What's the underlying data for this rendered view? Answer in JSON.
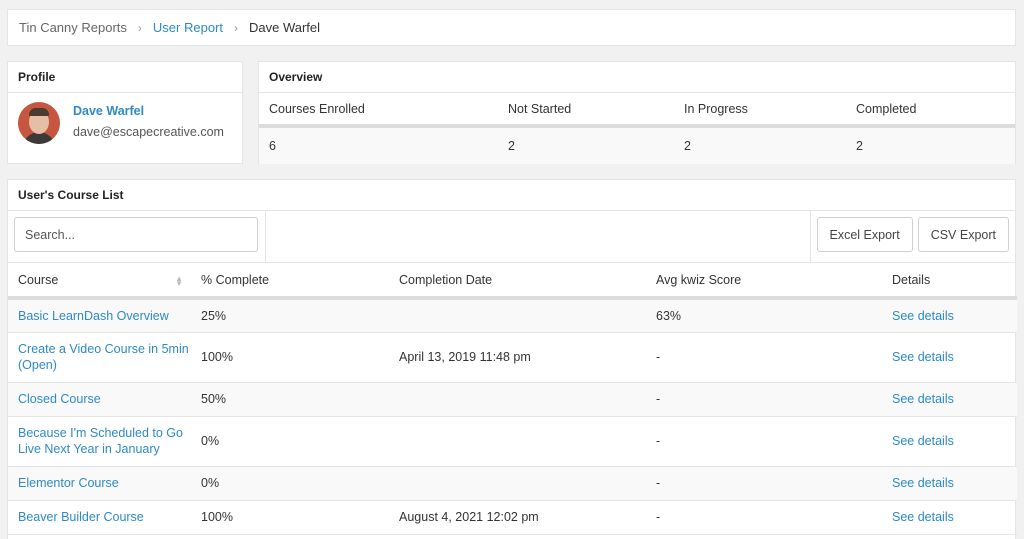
{
  "breadcrumb": [
    "Tin Canny Reports",
    "User Report",
    "Dave Warfel"
  ],
  "profile": {
    "title": "Profile",
    "name": "Dave Warfel",
    "email": "dave@escapecreative.com"
  },
  "overview": {
    "title": "Overview",
    "headers": [
      "Courses Enrolled",
      "Not Started",
      "In Progress",
      "Completed"
    ],
    "values": [
      "6",
      "2",
      "2",
      "2"
    ]
  },
  "course_list": {
    "title": "User's Course List",
    "search_placeholder": "Search...",
    "excel_label": "Excel Export",
    "csv_label": "CSV Export",
    "columns": [
      "Course",
      "% Complete",
      "Completion Date",
      "Avg kwiz Score",
      "Details"
    ],
    "rows": [
      {
        "course": "Basic LearnDash Overview",
        "pct": "25%",
        "date": "",
        "score": "63%",
        "details": "See details"
      },
      {
        "course": "Create a Video Course in 5min (Open)",
        "pct": "100%",
        "date": "April 13, 2019 11:48 pm",
        "score": "-",
        "details": "See details"
      },
      {
        "course": "Closed Course",
        "pct": "50%",
        "date": "",
        "score": "-",
        "details": "See details"
      },
      {
        "course": "Because I'm Scheduled to Go Live Next Year in January",
        "pct": "0%",
        "date": "",
        "score": "-",
        "details": "See details"
      },
      {
        "course": "Elementor Course",
        "pct": "0%",
        "date": "",
        "score": "-",
        "details": "See details"
      },
      {
        "course": "Beaver Builder Course",
        "pct": "100%",
        "date": "August 4, 2021 12:02 pm",
        "score": "-",
        "details": "See details"
      }
    ]
  },
  "colors": {
    "link": "#2d8ac7",
    "background": "#f1f1f1",
    "panel": "#ffffff"
  },
  "icons": {
    "breadcrumb_separator": "chevron-right-icon",
    "sort": "sort-icon"
  }
}
